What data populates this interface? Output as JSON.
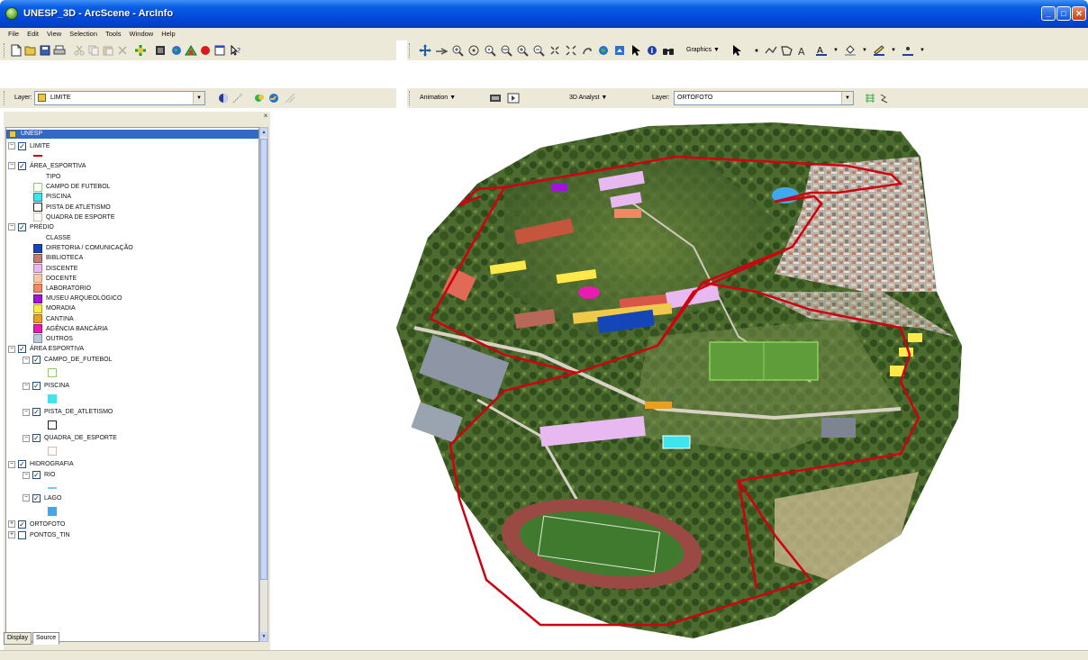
{
  "window": {
    "title": "UNESP_3D - ArcScene - ArcInfo"
  },
  "menu": [
    "File",
    "Edit",
    "View",
    "Selection",
    "Tools",
    "Window",
    "Help"
  ],
  "toolbar_row2": {
    "layer_label": "Layer:",
    "layer_value": "LIMITE",
    "animation_label": "Animation ▼",
    "analyst_label": "3D Analyst ▼",
    "layer2_label": "Layer:",
    "layer2_value": "ORTOFOTO",
    "graphics_label": "Graphics ▼"
  },
  "toc": {
    "root": "UNESP",
    "tabs": [
      "Display",
      "Source"
    ],
    "rows": [
      {
        "kind": "layer",
        "expander": "−",
        "checked": true,
        "label": "LIMITE"
      },
      {
        "kind": "line",
        "color": "#d00010",
        "label": ""
      },
      {
        "kind": "layer",
        "expander": "−",
        "checked": true,
        "label": "ÁREA_ESPORTIVA"
      },
      {
        "kind": "text",
        "label": "TIPO"
      },
      {
        "kind": "class",
        "color": "#ffffff",
        "border": "#8bd35b",
        "label": "CAMPO DE FUTEBOL"
      },
      {
        "kind": "class",
        "color": "#3fe5ee",
        "border": "#1c8e94",
        "label": "PISCINA"
      },
      {
        "kind": "class",
        "color": "#ffffff",
        "border": "#222222",
        "label": "PISTA DE ATLETISMO"
      },
      {
        "kind": "class",
        "color": "#ffffff",
        "border": "#e2b8a0",
        "label": "QUADRA DE ESPORTE"
      },
      {
        "kind": "layer",
        "expander": "−",
        "checked": true,
        "label": "PRÉDIO"
      },
      {
        "kind": "text",
        "label": "CLASSE"
      },
      {
        "kind": "class",
        "color": "#1446b8",
        "border": "#0c2d7a",
        "label": "DIRETORIA / COMUNICAÇÃO"
      },
      {
        "kind": "class",
        "color": "#c47c70",
        "border": "#8a4d43",
        "label": "BIBLIOTECA"
      },
      {
        "kind": "class",
        "color": "#e8b8f0",
        "border": "#a07ab0",
        "label": "DISCENTE"
      },
      {
        "kind": "class",
        "color": "#f6c8a8",
        "border": "#c09070",
        "label": "DOCENTE"
      },
      {
        "kind": "class",
        "color": "#f08864",
        "border": "#b05a3a",
        "label": "LABORATÓRIO"
      },
      {
        "kind": "class",
        "color": "#a014d8",
        "border": "#640a8a",
        "label": "MUSEU ARQUEOLÓGICO"
      },
      {
        "kind": "class",
        "color": "#ffe84a",
        "border": "#b0a020",
        "label": "MORADIA"
      },
      {
        "kind": "class",
        "color": "#e8a020",
        "border": "#a06c10",
        "label": "CANTINA"
      },
      {
        "kind": "class",
        "color": "#e81cb0",
        "border": "#a00c78",
        "label": "AGÊNCIA BANCÁRIA"
      },
      {
        "kind": "class",
        "color": "#b8c8d8",
        "border": "#7890a8",
        "label": "OUTROS"
      },
      {
        "kind": "layer",
        "expander": "−",
        "checked": true,
        "label": "ÁREA ESPORTIVA"
      },
      {
        "kind": "sublayer",
        "expander": "−",
        "checked": true,
        "label": "CAMPO_DE_FUTEBOL"
      },
      {
        "kind": "subclass",
        "color": "#ffffff",
        "border": "#8bd35b",
        "label": ""
      },
      {
        "kind": "sublayer",
        "expander": "−",
        "checked": true,
        "label": "PISCINA"
      },
      {
        "kind": "subclass",
        "color": "#3fe5ee",
        "border": "#3fe5ee",
        "label": ""
      },
      {
        "kind": "sublayer",
        "expander": "−",
        "checked": true,
        "label": "PISTA_DE_ATLETISMO"
      },
      {
        "kind": "subclass",
        "color": "#ffffff",
        "border": "#222222",
        "label": ""
      },
      {
        "kind": "sublayer",
        "expander": "−",
        "checked": true,
        "label": "QUADRA_DE_ESPORTE"
      },
      {
        "kind": "subclass",
        "color": "#ffffff",
        "border": "#e2b8a0",
        "label": ""
      },
      {
        "kind": "layer",
        "expander": "−",
        "checked": true,
        "label": "HIDROGRAFIA"
      },
      {
        "kind": "sublayer",
        "expander": "−",
        "checked": true,
        "label": "RIO"
      },
      {
        "kind": "subline",
        "color": "#7fc6f5",
        "label": ""
      },
      {
        "kind": "sublayer",
        "expander": "−",
        "checked": true,
        "label": "LAGO"
      },
      {
        "kind": "subclass",
        "color": "#3fa9ef",
        "border": "#3fa9ef",
        "label": ""
      },
      {
        "kind": "layer",
        "expander": "+",
        "checked": true,
        "label": "ORTOFOTO"
      },
      {
        "kind": "layer",
        "expander": "+",
        "checked": false,
        "label": "PONTOS_TIN"
      }
    ]
  },
  "colors": {
    "limit_line": "#d00010",
    "selection": "#316ac5"
  }
}
